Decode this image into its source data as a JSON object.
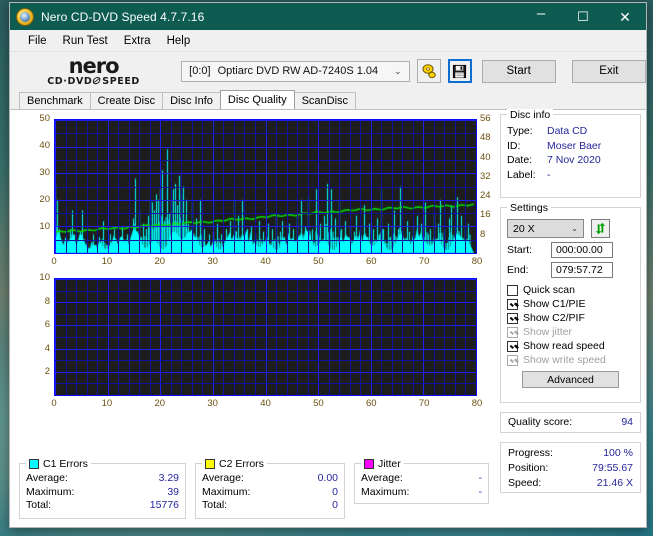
{
  "window": {
    "title": "Nero CD-DVD Speed 4.7.7.16",
    "app_icon": "nero-disc-icon",
    "minimize": "–",
    "maximize": "☐",
    "close": "✕"
  },
  "menu": {
    "items": [
      "File",
      "Run Test",
      "Extra",
      "Help"
    ]
  },
  "toolbar": {
    "logo_main": "nero",
    "logo_sub_left": "CD·DVD",
    "logo_sub_slash": "⊘",
    "logo_sub_right": "SPEED",
    "drive_bracket": "[0:0]",
    "drive_name": "Optiarc DVD RW AD-7240S 1.04",
    "chevron": "⌄",
    "eject_icon": "disc-eject-icon",
    "save_icon": "floppy-save-icon",
    "start_label": "Start",
    "exit_label": "Exit"
  },
  "tabs": [
    {
      "label": "Benchmark",
      "active": false
    },
    {
      "label": "Create Disc",
      "active": false
    },
    {
      "label": "Disc Info",
      "active": false
    },
    {
      "label": "Disc Quality",
      "active": true
    },
    {
      "label": "ScanDisc",
      "active": false
    }
  ],
  "disc_info": {
    "caption": "Disc info",
    "rows": [
      {
        "key": "Type:",
        "value": "Data CD"
      },
      {
        "key": "ID:",
        "value": "Moser Baer"
      },
      {
        "key": "Date:",
        "value": "7 Nov 2020"
      },
      {
        "key": "Label:",
        "value": "-"
      }
    ]
  },
  "settings": {
    "caption": "Settings",
    "speed_value": "20 X",
    "chevron": "⌄",
    "refresh_icon": "refresh-arrows-icon",
    "start_label": "Start:",
    "start_value": "000:00.00",
    "end_label": "End:",
    "end_value": "079:57.72",
    "checkboxes": [
      {
        "label": "Quick scan",
        "checked": false,
        "disabled": false
      },
      {
        "label": "Show C1/PIE",
        "checked": true,
        "disabled": false
      },
      {
        "label": "Show C2/PIF",
        "checked": true,
        "disabled": false
      },
      {
        "label": "Show jitter",
        "checked": true,
        "disabled": true
      },
      {
        "label": "Show read speed",
        "checked": true,
        "disabled": false
      },
      {
        "label": "Show write speed",
        "checked": true,
        "disabled": true
      }
    ],
    "advanced_label": "Advanced"
  },
  "quality": {
    "label": "Quality score:",
    "value": "94"
  },
  "progress": {
    "rows": [
      {
        "key": "Progress:",
        "value": "100 %"
      },
      {
        "key": "Position:",
        "value": "79:55.67"
      },
      {
        "key": "Speed:",
        "value": "21.46 X"
      }
    ]
  },
  "stats": [
    {
      "caption": "C1 Errors",
      "color": "#00ffff",
      "rows": [
        {
          "key": "Average:",
          "value": "3.29"
        },
        {
          "key": "Maximum:",
          "value": "39"
        },
        {
          "key": "Total:",
          "value": "15776"
        }
      ]
    },
    {
      "caption": "C2 Errors",
      "color": "#ffff00",
      "rows": [
        {
          "key": "Average:",
          "value": "0.00"
        },
        {
          "key": "Maximum:",
          "value": "0"
        },
        {
          "key": "Total:",
          "value": "0"
        }
      ]
    },
    {
      "caption": "Jitter",
      "color": "#ff00ff",
      "rows": [
        {
          "key": "Average:",
          "value": "-"
        },
        {
          "key": "Maximum:",
          "value": "-"
        }
      ]
    }
  ],
  "chart_data": [
    {
      "type": "area",
      "name": "c1-error-chart",
      "title": "",
      "xlabel": "",
      "ylabel": "",
      "xlim": [
        0,
        80
      ],
      "ylim": [
        0,
        50
      ],
      "y2lim": [
        0,
        56
      ],
      "xticks": [
        0,
        10,
        20,
        30,
        40,
        50,
        60,
        70,
        80
      ],
      "yticks": [
        10,
        20,
        30,
        40,
        50
      ],
      "y2ticks": [
        8,
        16,
        24,
        32,
        40,
        48,
        56
      ],
      "grid": true,
      "bg": "#1d1d1d",
      "grid_color": "#1e1ef0",
      "series": [
        {
          "name": "C1 Errors",
          "kind": "spike-area",
          "color": "#00ffff",
          "x": [
            0.0,
            0.4,
            0.8,
            1.2,
            1.6,
            2.0,
            2.4,
            2.8,
            3.2,
            3.6,
            4.0,
            4.4,
            4.8,
            5.2,
            5.6,
            6.0,
            6.4,
            6.8,
            7.2,
            7.6,
            8.0,
            8.4,
            8.8,
            9.2,
            9.6,
            10.0,
            10.4,
            10.8,
            11.2,
            11.6,
            12.0,
            12.4,
            12.8,
            13.2,
            13.6,
            14.0,
            14.4,
            14.8,
            15.2,
            15.6,
            16.0,
            16.4,
            16.8,
            17.2,
            17.6,
            18.0,
            18.4,
            18.8,
            19.2,
            19.6,
            20.0,
            20.4,
            20.8,
            21.2,
            21.6,
            22.0,
            22.4,
            22.8,
            23.2,
            23.6,
            24.0,
            24.4,
            24.8,
            25.2,
            25.6,
            26.0,
            26.4,
            26.8,
            27.2,
            27.6,
            28.0,
            28.4,
            28.8,
            29.2,
            29.6,
            30.0,
            30.4,
            30.8,
            31.2,
            31.6,
            32.0,
            32.4,
            32.8,
            33.2,
            33.6,
            34.0,
            34.4,
            34.8,
            35.2,
            35.6,
            36.0,
            36.4,
            36.8,
            37.2,
            37.6,
            38.0,
            38.4,
            38.8,
            39.2,
            39.6,
            40.0,
            40.4,
            40.8,
            41.2,
            41.6,
            42.0,
            42.4,
            42.8,
            43.2,
            43.6,
            44.0,
            44.4,
            44.8,
            45.2,
            45.6,
            46.0,
            46.4,
            46.8,
            47.2,
            47.6,
            48.0,
            48.4,
            48.8,
            49.2,
            49.6,
            50.0,
            50.4,
            50.8,
            51.2,
            51.6,
            52.0,
            52.4,
            52.8,
            53.2,
            53.6,
            54.0,
            54.4,
            54.8,
            55.2,
            55.6,
            56.0,
            56.4,
            56.8,
            57.2,
            57.6,
            58.0,
            58.4,
            58.8,
            59.2,
            59.6,
            60.0,
            60.4,
            60.8,
            61.2,
            61.6,
            62.0,
            62.4,
            62.8,
            63.2,
            63.6,
            64.0,
            64.4,
            64.8,
            65.2,
            65.6,
            66.0,
            66.4,
            66.8,
            67.2,
            67.6,
            68.0,
            68.4,
            68.8,
            69.2,
            69.6,
            70.0,
            70.4,
            70.8,
            71.2,
            71.6,
            72.0,
            72.4,
            72.8,
            73.2,
            73.6,
            74.0,
            74.4,
            74.8,
            75.2,
            75.6,
            76.0,
            76.4,
            76.8,
            77.2,
            77.6,
            78.0,
            78.4,
            78.8,
            79.2,
            79.6
          ],
          "y": [
            26,
            20,
            9,
            5,
            3,
            6,
            4,
            9,
            16,
            7,
            3,
            5,
            8,
            16,
            4,
            3,
            2,
            4,
            7,
            3,
            2,
            6,
            5,
            12,
            3,
            2,
            7,
            4,
            9,
            5,
            3,
            6,
            10,
            4,
            7,
            3,
            6,
            13,
            28,
            8,
            16,
            6,
            11,
            9,
            14,
            20,
            19,
            16,
            22,
            20,
            24,
            31,
            12,
            39,
            15,
            20,
            24,
            26,
            18,
            29,
            22,
            25,
            20,
            11,
            8,
            19,
            6,
            13,
            5,
            20,
            4,
            9,
            3,
            7,
            2,
            8,
            5,
            11,
            4,
            7,
            3,
            9,
            6,
            12,
            5,
            20,
            8,
            14,
            5,
            20,
            6,
            9,
            4,
            10,
            3,
            7,
            5,
            12,
            4,
            8,
            6,
            11,
            3,
            9,
            5,
            15,
            4,
            8,
            12,
            6,
            3,
            11,
            5,
            9,
            4,
            14,
            6,
            20,
            5,
            10,
            21,
            7,
            9,
            4,
            24,
            7,
            11,
            5,
            14,
            26,
            8,
            24,
            6,
            13,
            5,
            20,
            9,
            4,
            12,
            6,
            10,
            3,
            8,
            14,
            5,
            9,
            4,
            18,
            6,
            11,
            3,
            9,
            5,
            13,
            7,
            24,
            9,
            4,
            11,
            6,
            10,
            16,
            4,
            9,
            25,
            7,
            5,
            12,
            8,
            3,
            10,
            5,
            14,
            6,
            11,
            4,
            19,
            7,
            9,
            3,
            15,
            5,
            11,
            20,
            6,
            9,
            4,
            13,
            18,
            5,
            10,
            21,
            7,
            14,
            5,
            9,
            11
          ]
        },
        {
          "name": "Read speed",
          "kind": "line",
          "color": "#00dd00",
          "axis": "right",
          "x": [
            0,
            4,
            8,
            12,
            16,
            20,
            24,
            28,
            32,
            36,
            40,
            44,
            48,
            52,
            56,
            60,
            64,
            68,
            72,
            76,
            79.6
          ],
          "y": [
            8.6,
            9.4,
            9.9,
            10.5,
            11.1,
            11.8,
            12.4,
            13.0,
            13.7,
            14.4,
            15.2,
            15.9,
            16.6,
            17.3,
            17.9,
            18.4,
            18.8,
            19.2,
            19.5,
            19.9,
            20.4
          ]
        }
      ]
    },
    {
      "type": "area",
      "name": "c2-error-chart",
      "title": "",
      "xlim": [
        0,
        80
      ],
      "ylim": [
        0,
        10
      ],
      "xticks": [
        0,
        10,
        20,
        30,
        40,
        50,
        60,
        70,
        80
      ],
      "yticks": [
        2,
        4,
        6,
        8,
        10
      ],
      "grid": true,
      "bg": "#1d1d1d",
      "grid_color": "#1e1ef0",
      "series": [
        {
          "name": "C2 Errors",
          "kind": "spike-area",
          "color": "#ffff00",
          "x": [],
          "y": []
        }
      ]
    }
  ]
}
